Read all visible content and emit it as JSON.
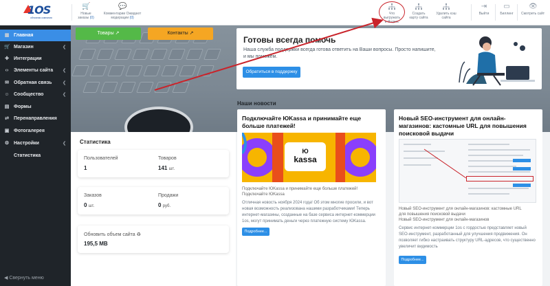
{
  "topbar": {
    "logo_text": "1OS",
    "logo_sub": "облачная компания",
    "new_orders": {
      "label_line1": "Новые",
      "label_line2": "заказы",
      "count": "(0)"
    },
    "comments": {
      "label_line1": "Комментарии Ожидают",
      "label_line2": "модерации",
      "count": "(0)"
    },
    "upload_list": {
      "line1": "Что",
      "line2": "выгружать",
      "line3": "в Яндекс"
    },
    "create_sitemap": {
      "line1": "Создать",
      "line2": "карту сайта"
    },
    "clear_cache": {
      "line1": "Удалить кэш",
      "line2": "сайта"
    },
    "logout": "Выйти",
    "billing": "Биллинг",
    "view_site": "Смотреть сайт"
  },
  "sidebar": {
    "items": [
      {
        "label": "Главная",
        "icon": "grid-icon",
        "active": true,
        "chevron": false
      },
      {
        "label": "Магазин",
        "icon": "cart-icon",
        "active": false,
        "chevron": true
      },
      {
        "label": "Интеграции",
        "icon": "puzzle-icon",
        "active": false,
        "chevron": false
      },
      {
        "label": "Элементы сайта",
        "icon": "code-icon",
        "active": false,
        "chevron": true
      },
      {
        "label": "Обратная связь",
        "icon": "chat-icon",
        "active": false,
        "chevron": true
      },
      {
        "label": "Сообщество",
        "icon": "users-icon",
        "active": false,
        "chevron": true
      },
      {
        "label": "Формы",
        "icon": "form-icon",
        "active": false,
        "chevron": false
      },
      {
        "label": "Перенаправления",
        "icon": "redirect-icon",
        "active": false,
        "chevron": false
      },
      {
        "label": "Фотогалерея",
        "icon": "photo-icon",
        "active": false,
        "chevron": false
      },
      {
        "label": "Настройки",
        "icon": "gear-icon",
        "active": false,
        "chevron": true
      },
      {
        "label": "Статистика",
        "icon": "",
        "active": false,
        "chevron": false,
        "sub": true
      }
    ],
    "collapse_label": "Свернуть меню"
  },
  "quick": {
    "products_label": "Товары",
    "contacts_label": "Контакты"
  },
  "support": {
    "title": "Готовы всегда помочь",
    "text": "Наша служба поддержки всегда готова ответить на Ваши вопросы. Просто напишите, и мы поможем.",
    "button": "Обратиться в поддержку"
  },
  "news_section_title": "Наши новости",
  "stats": {
    "title": "Статистика",
    "users_label": "Пользователей",
    "users_value": "1",
    "products_label": "Товаров",
    "products_value": "141",
    "products_unit": "шт.",
    "orders_label": "Заказов",
    "orders_value": "0",
    "orders_unit": "шт.",
    "sales_label": "Продажи",
    "sales_value": "0",
    "sales_unit": "руб.",
    "volume_label": "Обновить объем сайта",
    "volume_value": "195,5 MB"
  },
  "news": [
    {
      "title": "Подключайте ЮKassa и принимайте еще больше платежей!",
      "banner_text": "kassa",
      "caption_line1": "Подключайте ЮKassa и принимайте еще больше платежей!",
      "caption_line2": "Подключайте ЮKassa",
      "body": "Отличная новость ноября 2024 года! Об этом многие просили, и вот новая возможность реализована нашими разработчиками! Теперь интернет-магазины, созданные на базе сервиса интернет-коммерции 1os, могут принимать деньги через платежную систему ЮKassa.",
      "more": "Подробнее..."
    },
    {
      "title": "Новый SEO-инструмент для онлайн-магазинов: кастомные URL для повышения поисковой выдачи",
      "caption_line1": "Новый SEO-инструмент для онлайн-магазинов: кастомные URL",
      "caption_line2": "для повышения поисковой выдачи",
      "caption_line3": "Новый SEO-инструмент для онлайн-магазинов",
      "body": "Сервис интернет-коммерции 1os с гордостью представляет новый SEO-инструмент, разработанный для улучшения продвижения. Он позволяет гибко настраивать структуру URL-адресов, что существенно увеличит видимость",
      "more": "Подробнее..."
    }
  ],
  "colors": {
    "accent": "#2d8fe6",
    "sidebar_bg": "#1f2429",
    "green": "#54b948",
    "orange": "#f5a623",
    "annotation_red": "#c9232a"
  }
}
